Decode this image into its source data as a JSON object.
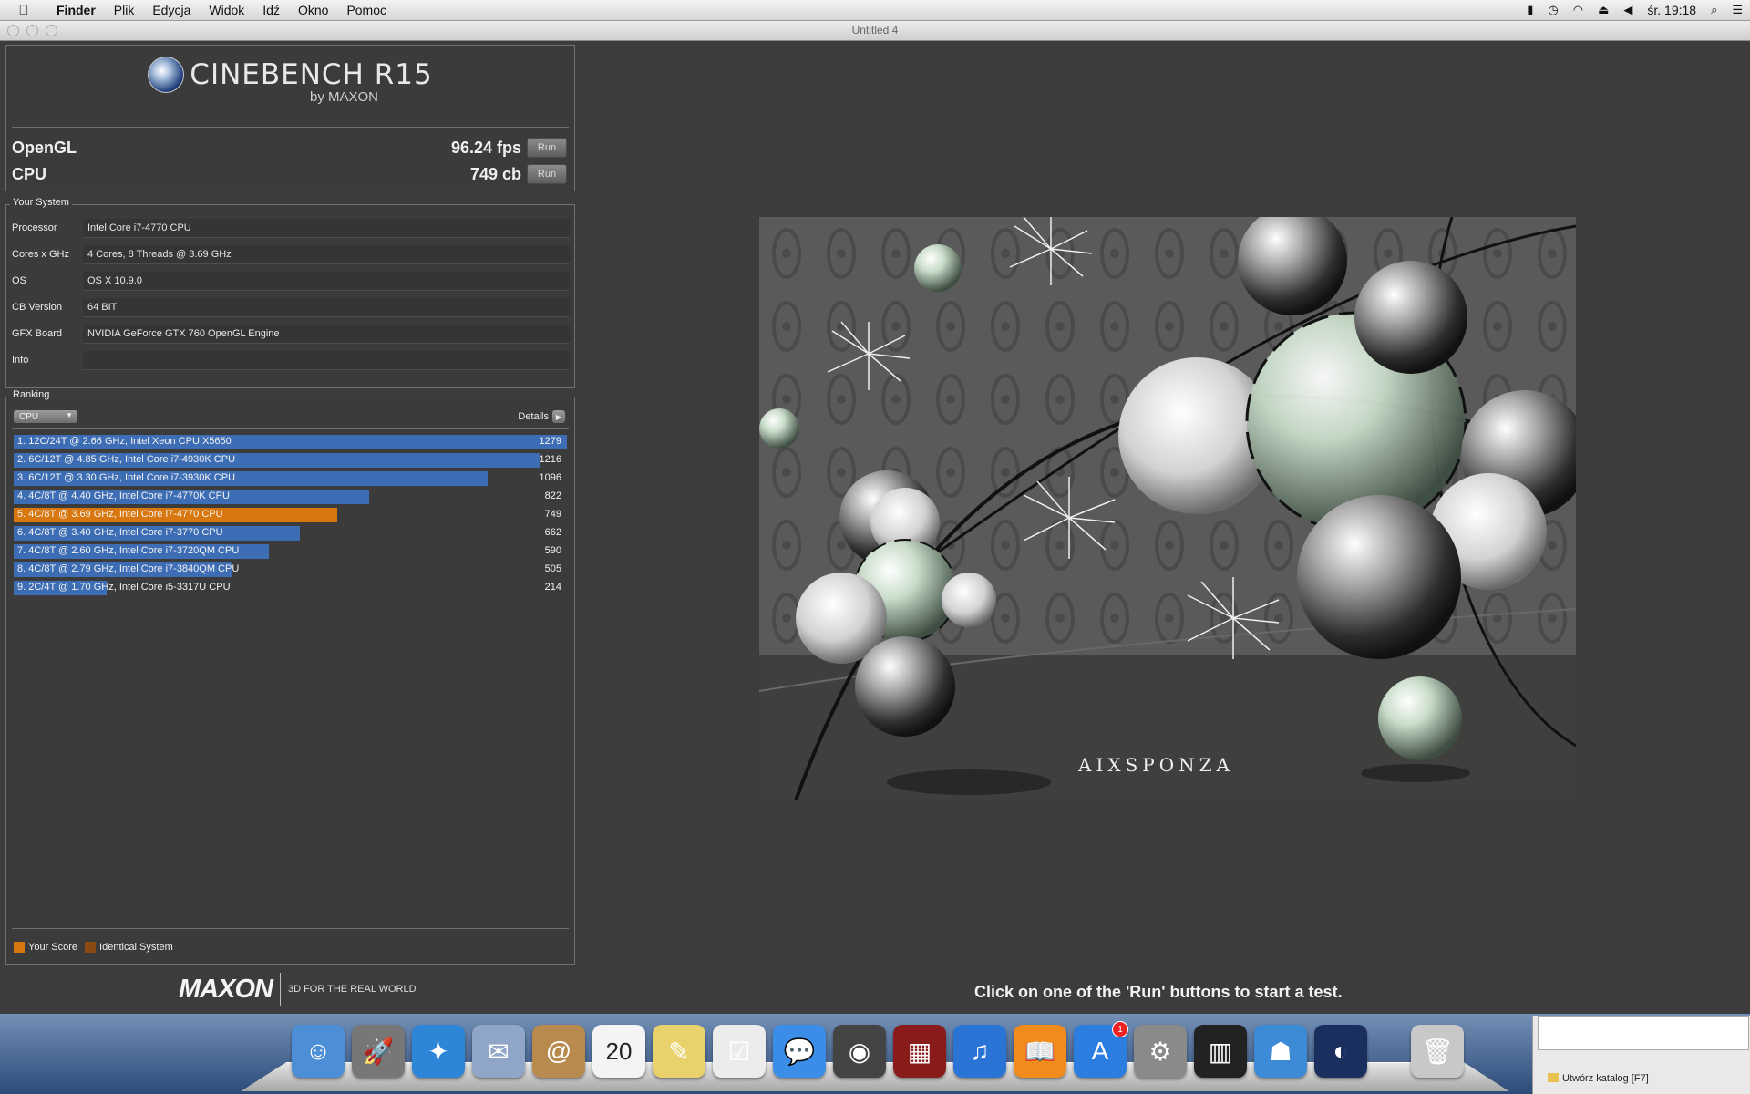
{
  "menubar": {
    "app_name": "Finder",
    "items": [
      "Plik",
      "Edycja",
      "Widok",
      "Idź",
      "Okno",
      "Pomoc"
    ],
    "clock": "śr. 19:18"
  },
  "window": {
    "title": "Untitled 4"
  },
  "logo": {
    "product": "CINEBENCH R15",
    "by": "by MAXON"
  },
  "scores": {
    "opengl_label": "OpenGL",
    "opengl_value": "96.24 fps",
    "cpu_label": "CPU",
    "cpu_value": "749 cb",
    "run_label": "Run"
  },
  "system": {
    "title": "Your System",
    "rows": [
      {
        "key": "Processor",
        "value": "Intel Core i7-4770 CPU"
      },
      {
        "key": "Cores x GHz",
        "value": "4 Cores, 8 Threads @ 3.69 GHz"
      },
      {
        "key": "OS",
        "value": "OS X 10.9.0"
      },
      {
        "key": "CB Version",
        "value": "64 BIT"
      },
      {
        "key": "GFX Board",
        "value": "NVIDIA GeForce GTX 760 OpenGL Engine"
      },
      {
        "key": "Info",
        "value": ""
      }
    ]
  },
  "ranking": {
    "title": "Ranking",
    "selector": "CPU",
    "details_label": "Details",
    "max_score": 1279,
    "entries": [
      {
        "label": "1. 12C/24T @ 2.66 GHz, Intel Xeon CPU X5650",
        "score": 1279,
        "kind": "other"
      },
      {
        "label": "2. 6C/12T @ 4.85 GHz, Intel Core i7-4930K CPU",
        "score": 1216,
        "kind": "other"
      },
      {
        "label": "3. 6C/12T @ 3.30 GHz,  Intel Core i7-3930K CPU",
        "score": 1096,
        "kind": "other"
      },
      {
        "label": "4. 4C/8T @ 4.40 GHz, Intel Core i7-4770K CPU",
        "score": 822,
        "kind": "other"
      },
      {
        "label": "5. 4C/8T @ 3.69 GHz, Intel Core i7-4770 CPU",
        "score": 749,
        "kind": "yours"
      },
      {
        "label": "6. 4C/8T @ 3.40 GHz,  Intel Core i7-3770 CPU",
        "score": 662,
        "kind": "other"
      },
      {
        "label": "7. 4C/8T @ 2.60 GHz, Intel Core i7-3720QM CPU",
        "score": 590,
        "kind": "other"
      },
      {
        "label": "8. 4C/8T @ 2.79 GHz,  Intel Core i7-3840QM CPU",
        "score": 505,
        "kind": "other"
      },
      {
        "label": "9. 2C/4T @ 1.70 GHz,  Intel Core i5-3317U CPU",
        "score": 214,
        "kind": "other"
      }
    ],
    "legend": {
      "your_score": "Your Score",
      "identical": "Identical System"
    }
  },
  "colors": {
    "bar_other": "#3d6db4",
    "bar_yours": "#d9770f",
    "identical": "#8a4a12"
  },
  "footer": {
    "brand": "MAXON",
    "tagline": "3D FOR THE REAL WORLD",
    "hint": "Click on one of the 'Run' buttons to start a test."
  },
  "render": {
    "watermark": "AIXSPONZA"
  },
  "dock": {
    "icons": [
      "finder-icon",
      "launchpad-icon",
      "safari-icon",
      "mail-icon",
      "contacts-icon",
      "calendar-icon",
      "notes-icon",
      "reminders-icon",
      "messages-icon",
      "facetime-icon",
      "photo-booth-icon",
      "itunes-icon",
      "ibooks-icon",
      "app-store-icon",
      "system-preferences-icon",
      "garageband-icon",
      "network-icon",
      "cinebench-icon",
      "trash-icon"
    ],
    "calendar_day": "20",
    "appstore_badge": "1"
  },
  "finder_status": {
    "label": "Utwórz katalog [F7]"
  }
}
